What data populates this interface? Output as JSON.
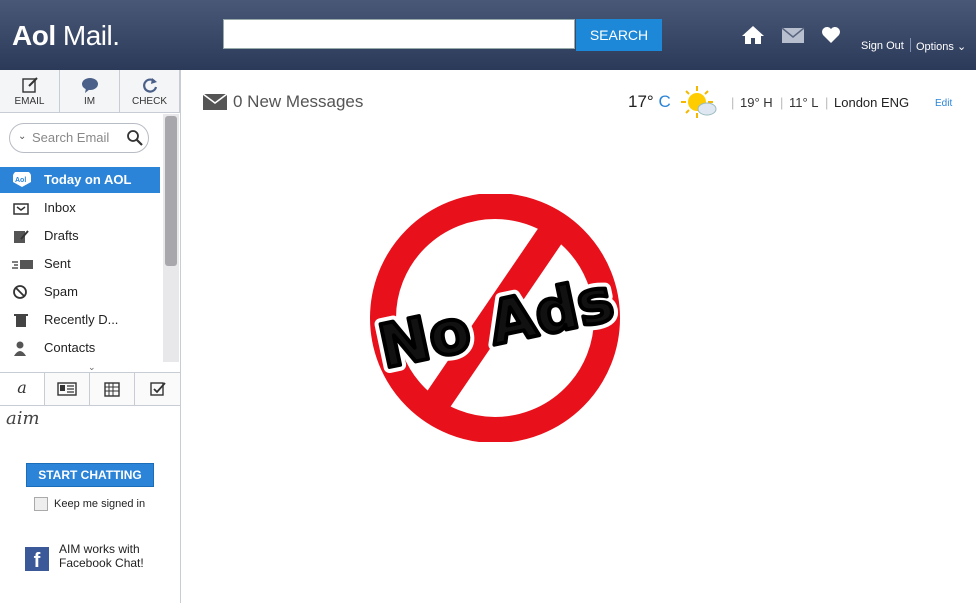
{
  "header": {
    "logo_brand": "Aol",
    "logo_product": "Mail.",
    "search_placeholder": "",
    "search_button": "SEARCH",
    "sign_out": "Sign Out",
    "options": "Options"
  },
  "sidebar": {
    "tools": [
      {
        "label": "EMAIL",
        "icon": "compose-icon"
      },
      {
        "label": "IM",
        "icon": "chat-bubble-icon"
      },
      {
        "label": "CHECK",
        "icon": "refresh-icon"
      }
    ],
    "search_placeholder": "Search Email",
    "folders": [
      {
        "label": "Today on AOL",
        "icon": "aol-icon",
        "active": true
      },
      {
        "label": "Inbox",
        "icon": "inbox-icon"
      },
      {
        "label": "Drafts",
        "icon": "drafts-icon"
      },
      {
        "label": "Sent",
        "icon": "sent-icon"
      },
      {
        "label": "Spam",
        "icon": "spam-icon"
      },
      {
        "label": "Recently D...",
        "icon": "trash-icon"
      },
      {
        "label": "Contacts",
        "icon": "contacts-icon"
      }
    ],
    "aim_label": "aim",
    "start_chatting": "START CHATTING",
    "keep_signed_in": "Keep me signed in",
    "facebook_text": "AIM works with Facebook Chat!"
  },
  "main": {
    "new_messages": "0 New Messages",
    "weather": {
      "temp": "17°",
      "unit": "C",
      "high": "19° H",
      "low": "11° L",
      "location": "London ENG",
      "edit": "Edit"
    },
    "banner_text": "No Ads"
  },
  "colors": {
    "accent": "#2b84d8",
    "header": "#3a4866",
    "no_ads_red": "#e8101a"
  }
}
